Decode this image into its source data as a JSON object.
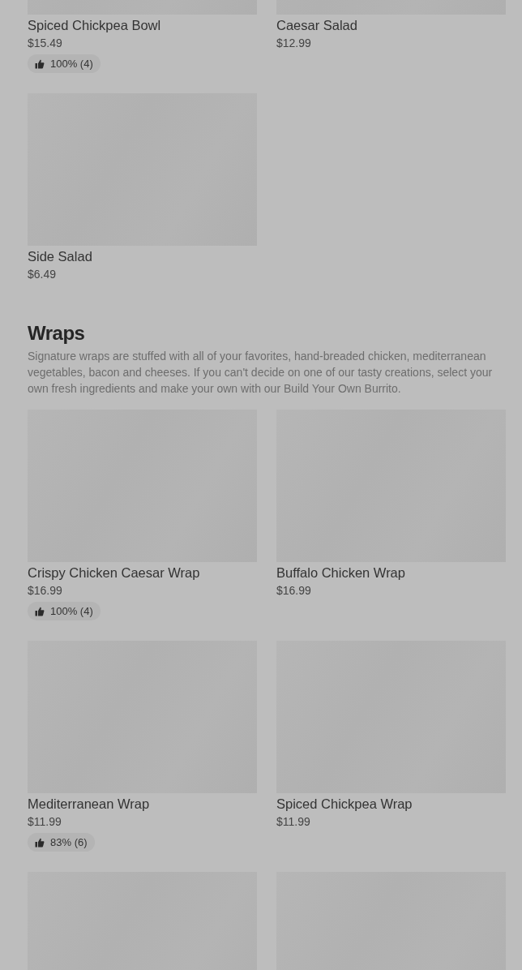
{
  "sections": [
    {
      "items": [
        {
          "kind": "item",
          "name": "Spiced Chickpea Bowl",
          "price": "$15.49",
          "rating": "100% (4)"
        },
        {
          "kind": "item",
          "name": "Caesar Salad",
          "price": "$12.99"
        },
        {
          "kind": "item",
          "name": "Side Salad",
          "price": "$6.49"
        }
      ]
    },
    {
      "title": "Wraps",
      "description": "Signature wraps are stuffed with all of your favorites, hand-breaded chicken, mediterranean vegetables, bacon and cheeses. If you can't decide on one of our tasty creations, select your own fresh ingredients and make your own with our Build Your Own Burrito.",
      "items": [
        {
          "kind": "item",
          "name": "Crispy Chicken Caesar Wrap",
          "price": "$16.99",
          "rating": "100% (4)"
        },
        {
          "kind": "item",
          "name": "Buffalo Chicken Wrap",
          "price": "$16.99"
        },
        {
          "kind": "item",
          "name": "Mediterranean Wrap",
          "price": "$11.99",
          "rating": "83% (6)"
        },
        {
          "kind": "item",
          "name": "Spiced Chickpea Wrap",
          "price": "$11.99"
        },
        {
          "kind": "cutoff"
        },
        {
          "kind": "cutoff"
        }
      ]
    }
  ]
}
